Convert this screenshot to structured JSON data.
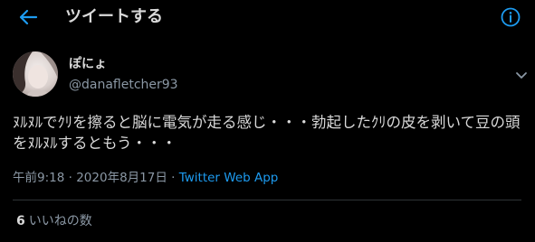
{
  "header": {
    "title": "ツイートする"
  },
  "tweet": {
    "display_name": "ぽにょ",
    "handle": "@danafletcher93",
    "text": "ﾇﾙﾇﾙでｸﾘを擦ると脳に電気が走る感じ・・・勃起したｸﾘの皮を剥いて豆の頭をﾇﾙﾇﾙするともう・・・",
    "time": "午前9:18",
    "separator": "·",
    "date": "2020年8月17日",
    "source": "Twitter Web App"
  },
  "stats": {
    "likes_count": "6",
    "likes_label": "いいねの数"
  },
  "colors": {
    "background": "#000000",
    "text_primary": "#d9d9d9",
    "text_secondary": "#8b98a5",
    "accent": "#1d9bf0",
    "divider": "#2f3336"
  },
  "icons": {
    "back": "arrow-left-icon",
    "info": "info-icon",
    "more": "chevron-down-icon"
  }
}
